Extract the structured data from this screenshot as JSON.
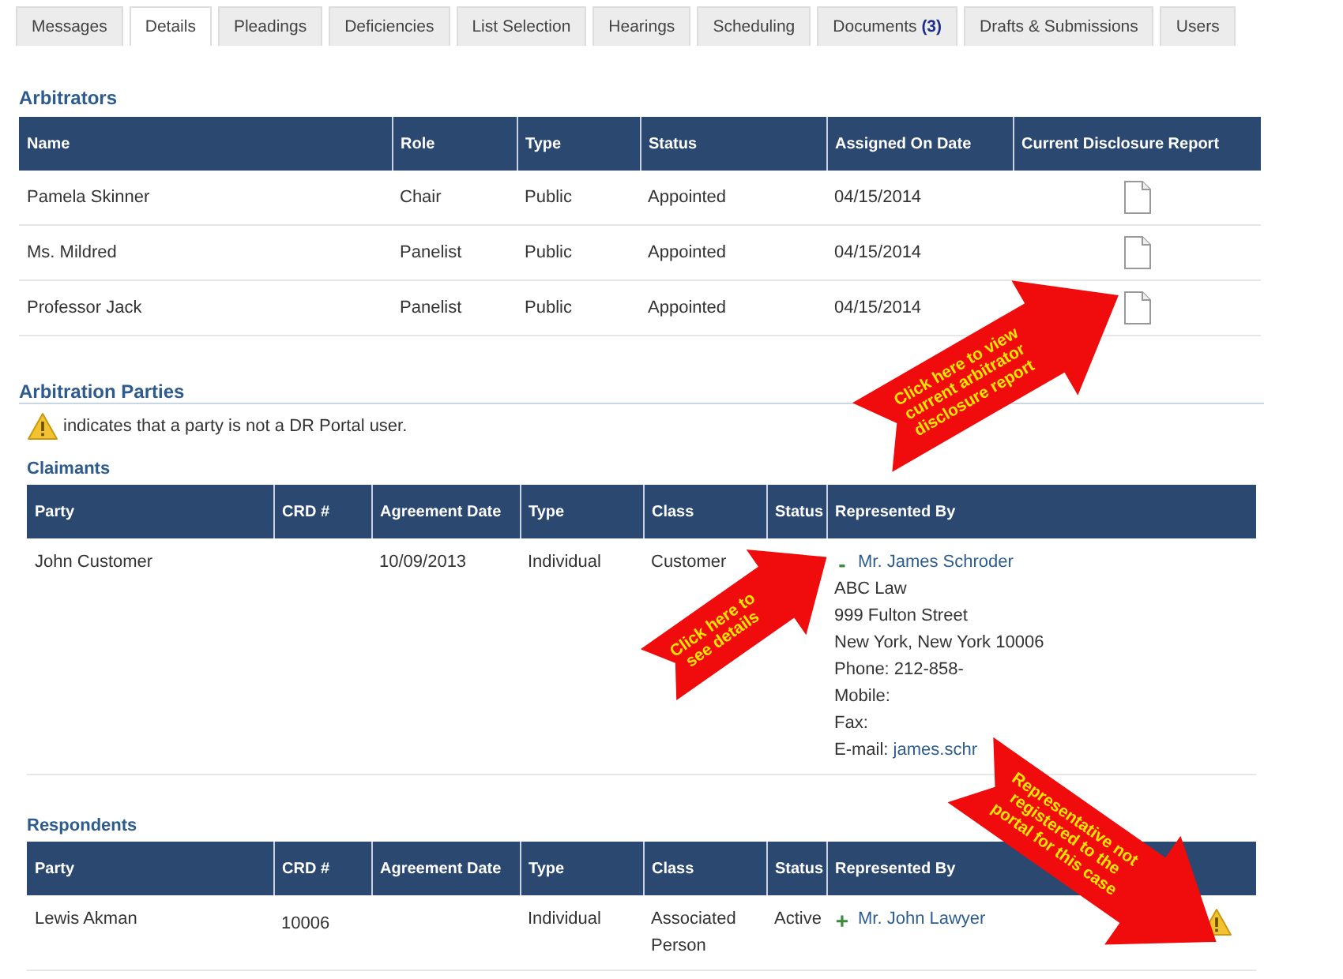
{
  "tabs": [
    {
      "label": "Messages",
      "selected": false
    },
    {
      "label": "Details",
      "selected": true
    },
    {
      "label": "Pleadings",
      "selected": false
    },
    {
      "label": "Deficiencies",
      "selected": false
    },
    {
      "label": "List Selection",
      "selected": false
    },
    {
      "label": "Hearings",
      "selected": false
    },
    {
      "label": "Scheduling",
      "selected": false
    },
    {
      "label": "Documents",
      "count": "(3)",
      "selected": false
    },
    {
      "label": "Drafts & Submissions",
      "selected": false
    },
    {
      "label": "Users",
      "selected": false
    }
  ],
  "arbitrators": {
    "title": "Arbitrators",
    "columns": [
      "Name",
      "Role",
      "Type",
      "Status",
      "Assigned On Date",
      "Current Disclosure Report"
    ],
    "rows": [
      {
        "name": "Pamela Skinner",
        "role": "Chair",
        "type": "Public",
        "status": "Appointed",
        "assigned": "04/15/2014"
      },
      {
        "name": "Ms. Mildred",
        "role": "Panelist",
        "type": "Public",
        "status": "Appointed",
        "assigned": "04/15/2014"
      },
      {
        "name": "Professor Jack",
        "role": "Panelist",
        "type": "Public",
        "status": "Appointed",
        "assigned": "04/15/2014"
      }
    ]
  },
  "parties": {
    "title": "Arbitration Parties",
    "legend": "indicates that a party is not a DR Portal user.",
    "groups": [
      {
        "title": "Claimants",
        "columns": [
          "Party",
          "CRD #",
          "Agreement Date",
          "Type",
          "Class",
          "Status",
          "Represented By"
        ],
        "rows": [
          {
            "party": "John Customer",
            "crd": "",
            "agreement": "10/09/2013",
            "type": "Individual",
            "class": "Customer",
            "status": "",
            "toggle": "-",
            "representative": "Mr. James Schroder",
            "expanded": true,
            "portal_user": true,
            "details": [
              "ABC Law",
              "999 Fulton Street",
              "New York, New York 10006",
              "Phone: 212-858-",
              "Mobile:",
              "Fax:"
            ],
            "email_label": "E-mail:",
            "email": "james.schr"
          }
        ]
      },
      {
        "title": "Respondents",
        "columns": [
          "Party",
          "CRD #",
          "Agreement Date",
          "Type",
          "Class",
          "Status",
          "Represented By"
        ],
        "rows": [
          {
            "party": "Lewis Akman",
            "crd": "10006",
            "agreement": "",
            "type": "Individual",
            "class": "Associated Person",
            "status": "Active",
            "toggle": "+",
            "representative": "Mr. John Lawyer",
            "expanded": false,
            "portal_user": false
          }
        ]
      }
    ]
  },
  "callouts": [
    {
      "text": "Click here to view current arbitrator disclosure report"
    },
    {
      "text": "Click here to see details"
    },
    {
      "text": "Representative not registered to the portal for this case"
    }
  ]
}
